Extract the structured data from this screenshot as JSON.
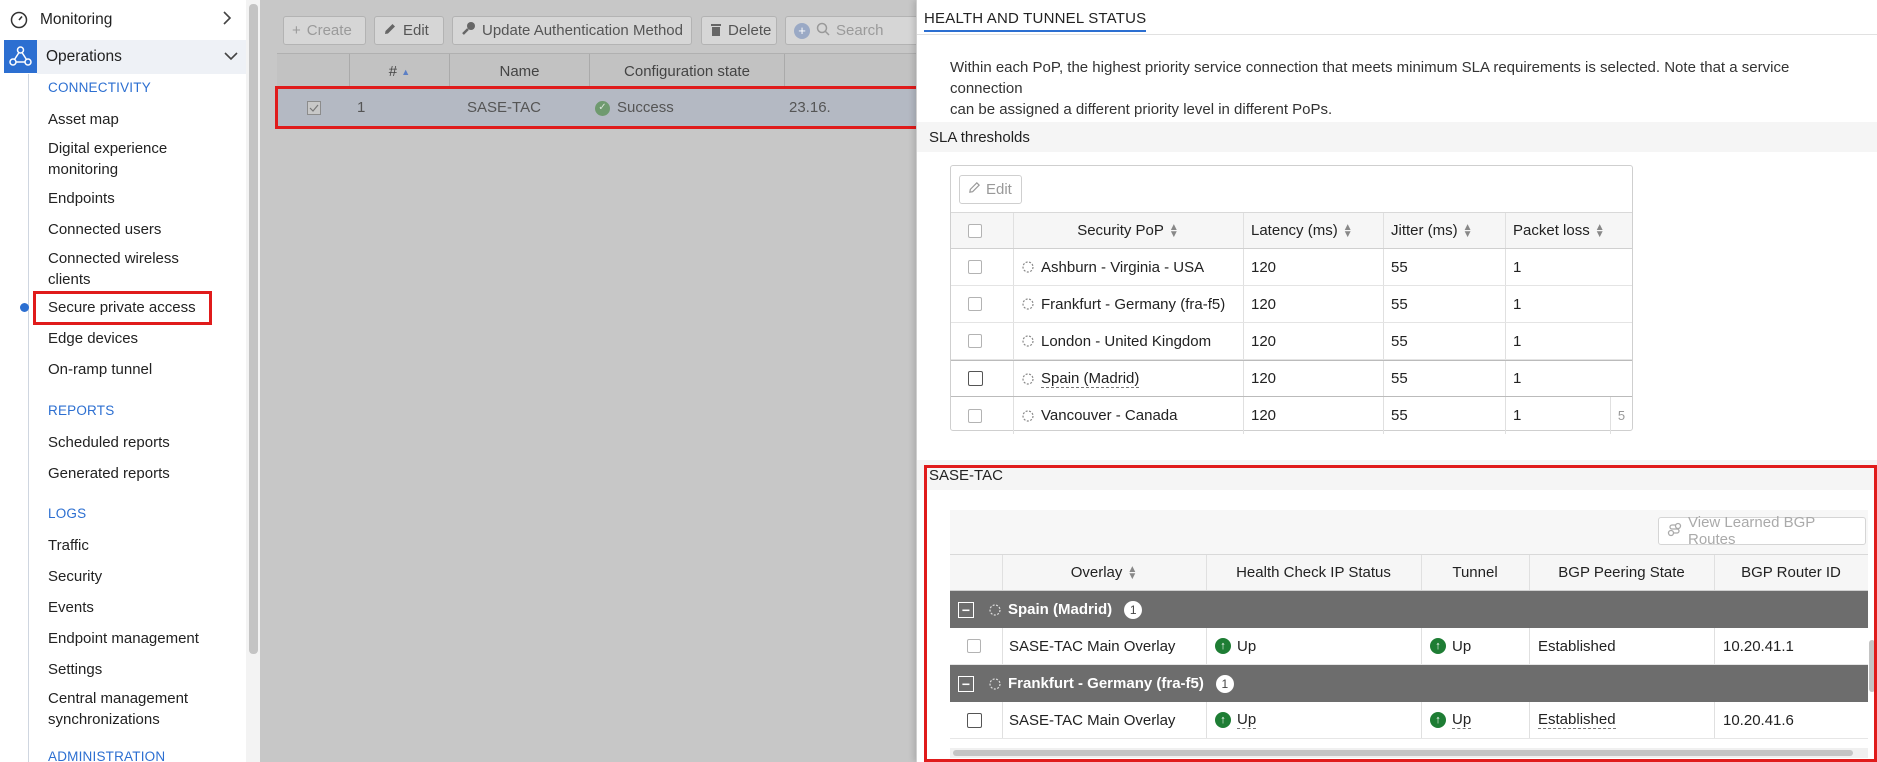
{
  "sidebar": {
    "monitoring": "Monitoring",
    "operations": "Operations",
    "sections": [
      {
        "head": "CONNECTIVITY"
      },
      {
        "head": "REPORTS"
      },
      {
        "head": "LOGS"
      },
      {
        "head": "ADMINISTRATION"
      }
    ],
    "items": {
      "asset_map": "Asset map",
      "dem_1": "Digital experience",
      "dem_2": "monitoring",
      "endpoints": "Endpoints",
      "connected_users": "Connected users",
      "cwc_1": "Connected wireless",
      "cwc_2": "clients",
      "spa": "Secure private access",
      "edge_devices": "Edge devices",
      "onramp": "On-ramp tunnel",
      "scheduled_reports": "Scheduled reports",
      "generated_reports": "Generated reports",
      "traffic": "Traffic",
      "security": "Security",
      "events": "Events",
      "endpoint_mgmt": "Endpoint management",
      "settings": "Settings",
      "cms_1": "Central management",
      "cms_2": "synchronizations"
    }
  },
  "main": {
    "toolbar": {
      "create": "Create",
      "edit": "Edit",
      "update_auth": "Update Authentication Method",
      "delete": "Delete",
      "search_placeholder": "Search"
    },
    "columns": [
      "#",
      "Name",
      "Configuration state"
    ],
    "row": {
      "num": "1",
      "name": "SASE-TAC",
      "state": "Success",
      "ip": "23.16."
    }
  },
  "drawer": {
    "title": "HEALTH AND TUNNEL STATUS",
    "description_1": "Within each PoP, the highest priority service connection that meets minimum SLA requirements is selected. Note that a service connection",
    "description_2": "can be assigned a different priority level in different PoPs.",
    "sla": {
      "section": "SLA thresholds",
      "edit": "Edit",
      "columns": [
        "Security PoP",
        "Latency (ms)",
        "Jitter (ms)",
        "Packet loss"
      ],
      "rows": [
        {
          "pop": "Ashburn - Virginia - USA",
          "latency": "120",
          "jitter": "55",
          "loss": "1"
        },
        {
          "pop": "Frankfurt - Germany (fra-f5)",
          "latency": "120",
          "jitter": "55",
          "loss": "1"
        },
        {
          "pop": "London - United Kingdom",
          "latency": "120",
          "jitter": "55",
          "loss": "1"
        },
        {
          "pop": "Spain (Madrid)",
          "latency": "120",
          "jitter": "55",
          "loss": "1"
        },
        {
          "pop": "Vancouver - Canada",
          "latency": "120",
          "jitter": "55",
          "loss": "1"
        }
      ],
      "pager": "5"
    },
    "sase": {
      "section": "SASE-TAC",
      "view_bgp": "View Learned BGP Routes",
      "columns": [
        "Overlay",
        "Health Check IP Status",
        "Tunnel",
        "BGP Peering State",
        "BGP Router ID"
      ],
      "groups": [
        {
          "name": "Spain (Madrid)",
          "count": "1",
          "row": {
            "overlay": "SASE-TAC Main Overlay",
            "health": "Up",
            "tunnel": "Up",
            "bgp": "Established",
            "router_id": "10.20.41.1"
          }
        },
        {
          "name": "Frankfurt - Germany (fra-f5)",
          "count": "1",
          "row": {
            "overlay": "SASE-TAC Main Overlay",
            "health": "Up",
            "tunnel": "Up",
            "bgp": "Established",
            "router_id": "10.20.41.6"
          }
        }
      ]
    }
  },
  "colors": {
    "accent": "#2c6fd1",
    "highlight": "#e01b1b",
    "up": "#1e7d34",
    "group_row": "#6d6d6d"
  }
}
